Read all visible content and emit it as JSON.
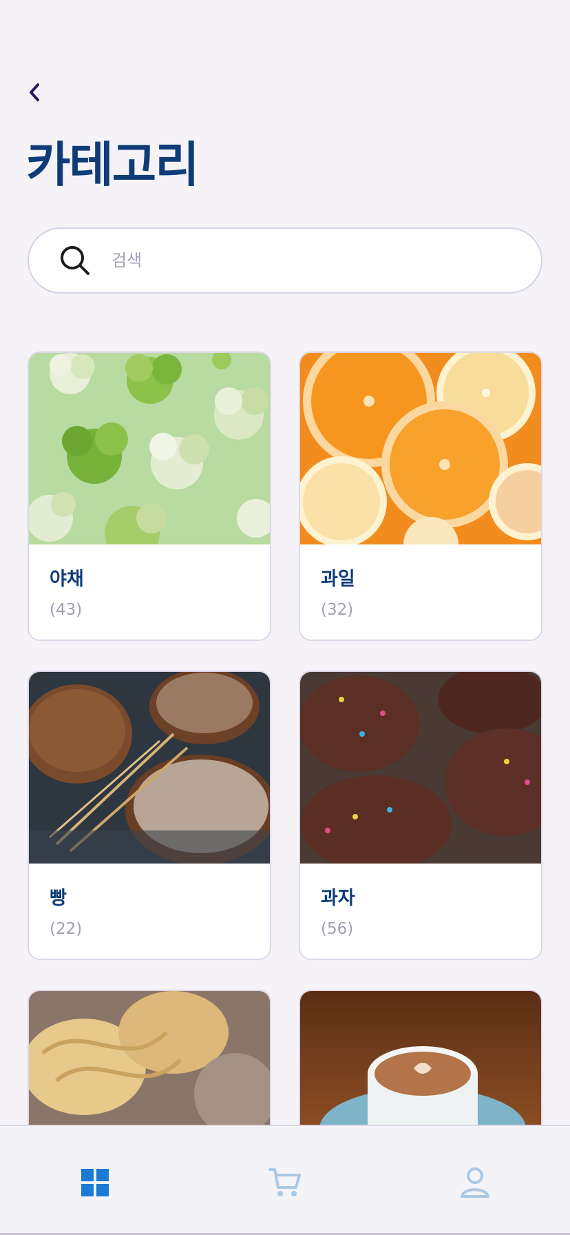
{
  "header": {
    "title": "카테고리",
    "back_icon": "chevron-left-icon"
  },
  "search": {
    "placeholder": "검색",
    "icon": "search-icon"
  },
  "categories": [
    {
      "name": "야채",
      "count": "(43)",
      "image": "vegetables-broccoli"
    },
    {
      "name": "과일",
      "count": "(32)",
      "image": "fruit-citrus-slices"
    },
    {
      "name": "빵",
      "count": "(22)",
      "image": "bread-loaves"
    },
    {
      "name": "과자",
      "count": "(56)",
      "image": "chocolate-cupcakes"
    },
    {
      "name": "",
      "count": "",
      "image": "pasta-noodles"
    },
    {
      "name": "",
      "count": "",
      "image": "coffee-cup"
    }
  ],
  "tabbar": {
    "items": [
      {
        "icon": "grid-icon",
        "active": true
      },
      {
        "icon": "cart-icon",
        "active": false
      },
      {
        "icon": "user-icon",
        "active": false
      }
    ]
  },
  "colors": {
    "background": "#f5f3f7",
    "title": "#0f3c78",
    "active_tab": "#1a7ad6",
    "inactive_tab": "#a9c9e6",
    "muted_text": "#a49db0"
  }
}
